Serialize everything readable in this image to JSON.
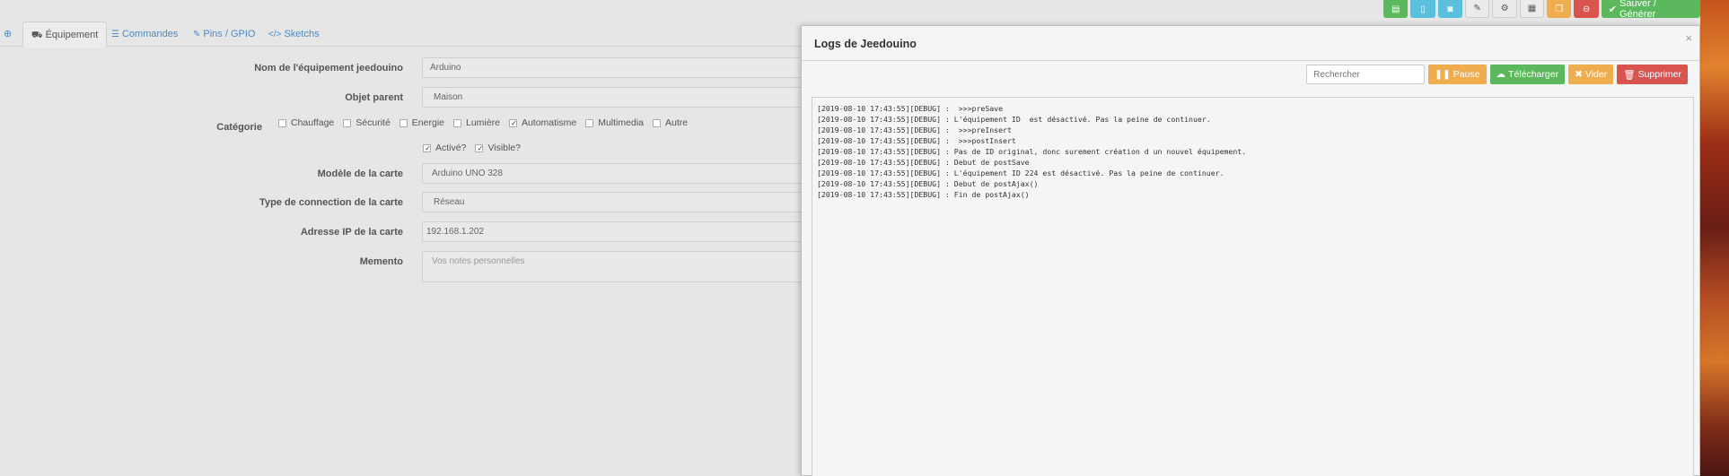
{
  "top_buttons": [
    {
      "icon": "book-icon",
      "glyph": "▤",
      "color": "green"
    },
    {
      "icon": "file-icon",
      "glyph": "▯",
      "color": "blue"
    },
    {
      "icon": "camera-icon",
      "glyph": "◙",
      "color": "blue"
    },
    {
      "icon": "wrench-icon",
      "glyph": "✎",
      "color": "gray"
    },
    {
      "icon": "cogs-icon",
      "glyph": "⚙",
      "color": "gray"
    },
    {
      "icon": "grid-icon",
      "glyph": "▦",
      "color": "gray"
    },
    {
      "icon": "copy-icon",
      "glyph": "❐",
      "color": "orange"
    },
    {
      "icon": "minus-circle-icon",
      "glyph": "⊖",
      "color": "red"
    }
  ],
  "save_button": {
    "label": "Sauver / Générer",
    "icon": "check-circle-icon"
  },
  "tabs": [
    {
      "label": "Équipement",
      "icon": "car-icon"
    },
    {
      "label": "Commandes",
      "icon": "list-icon"
    },
    {
      "label": "Pins / GPIO",
      "icon": "wrench-icon"
    },
    {
      "label": "Sketchs",
      "icon": "code-icon"
    }
  ],
  "form": {
    "name_label": "Nom de l'équipement jeedouino",
    "name_value": "Arduino",
    "parent_label": "Objet parent",
    "parent_value": "Maison",
    "category_label": "Catégorie",
    "categories": [
      {
        "label": "Chauffage",
        "checked": false
      },
      {
        "label": "Sécurité",
        "checked": false
      },
      {
        "label": "Energie",
        "checked": false
      },
      {
        "label": "Lumière",
        "checked": false
      },
      {
        "label": "Automatisme",
        "checked": true
      },
      {
        "label": "Multimedia",
        "checked": false
      },
      {
        "label": "Autre",
        "checked": false
      }
    ],
    "active_label": "Activé?",
    "visible_label": "Visible?",
    "model_label": "Modèle de la carte",
    "model_value": "Arduino UNO 328",
    "conn_label": "Type de connection de la carte",
    "conn_value": "Réseau",
    "ip_label": "Adresse IP de la carte",
    "ip_value": "192.168.1.202",
    "memento_label": "Memento",
    "memento_placeholder": "Vos notes personnelles"
  },
  "modal": {
    "title": "Logs de Jeedouino",
    "close": "×",
    "search_placeholder": "Rechercher",
    "pause_label": "Pause",
    "download_label": "Télécharger",
    "clear_label": "Vider",
    "delete_label": "Supprimer",
    "log_lines": [
      "[2019-08-10 17:43:55][DEBUG] :  >>>preSave",
      "[2019-08-10 17:43:55][DEBUG] : L'équipement ID  est désactivé. Pas la peine de continuer.",
      "[2019-08-10 17:43:55][DEBUG] :  >>>preInsert",
      "[2019-08-10 17:43:55][DEBUG] :  >>>postInsert",
      "[2019-08-10 17:43:55][DEBUG] : Pas de ID original, donc surement création d un nouvel équipement.",
      "[2019-08-10 17:43:55][DEBUG] : Debut de postSave",
      "[2019-08-10 17:43:55][DEBUG] : L'équipement ID 224 est désactivé. Pas la peine de continuer.",
      "[2019-08-10 17:43:55][DEBUG] : Debut de postAjax()",
      "[2019-08-10 17:43:55][DEBUG] : Fin de postAjax()"
    ]
  }
}
